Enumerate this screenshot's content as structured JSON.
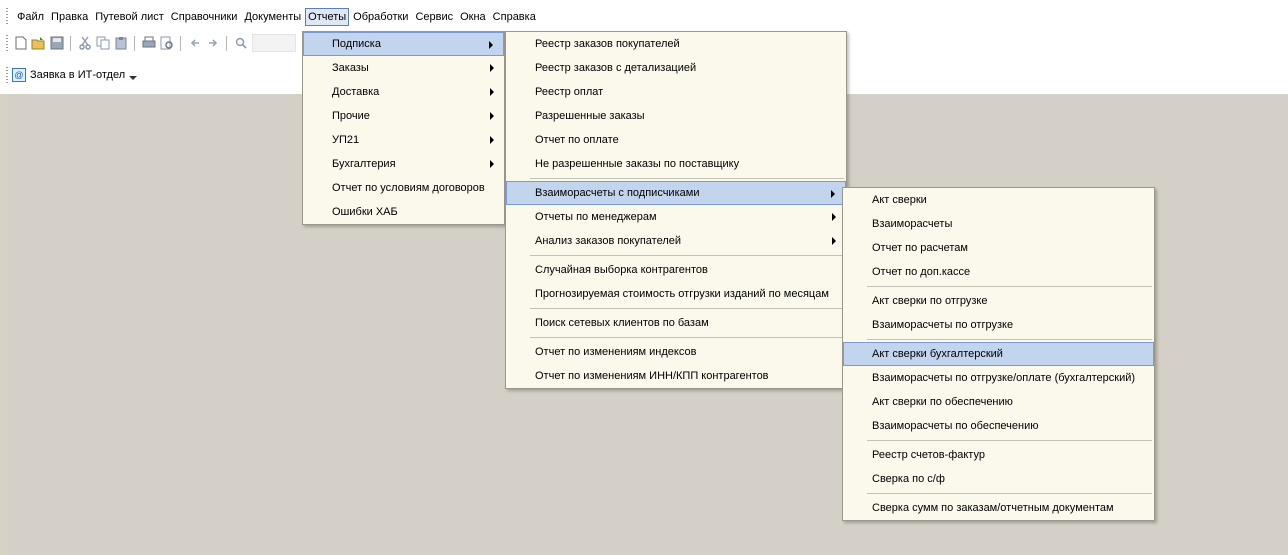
{
  "menubar": {
    "items": [
      {
        "label": "Файл",
        "active": false
      },
      {
        "label": "Правка",
        "active": false
      },
      {
        "label": "Путевой лист",
        "active": false
      },
      {
        "label": "Справочники",
        "active": false
      },
      {
        "label": "Документы",
        "active": false
      },
      {
        "label": "Отчеты",
        "active": true
      },
      {
        "label": "Обработки",
        "active": false
      },
      {
        "label": "Сервис",
        "active": false
      },
      {
        "label": "Окна",
        "active": false
      },
      {
        "label": "Справка",
        "active": false
      }
    ]
  },
  "toolbar": {
    "icons": [
      "new-document-icon",
      "open-icon",
      "save-icon",
      "cut-icon",
      "copy-icon",
      "paste-icon",
      "print-icon",
      "print-preview-icon",
      "back-icon",
      "forward-icon",
      "search-icon"
    ]
  },
  "quick_bar": {
    "it_request_label": "Заявка в ИТ-отдел"
  },
  "menu_reports": {
    "items": [
      {
        "label": "Подписка",
        "submenu": true,
        "highlighted": true
      },
      {
        "label": "Заказы",
        "submenu": true
      },
      {
        "label": "Доставка",
        "submenu": true
      },
      {
        "label": "Прочие",
        "submenu": true
      },
      {
        "label": "УП21",
        "submenu": true
      },
      {
        "label": "Бухгалтерия",
        "submenu": true
      },
      {
        "label": "Отчет по условиям договоров",
        "submenu": false
      },
      {
        "label": "Ошибки ХАБ",
        "submenu": false
      }
    ]
  },
  "menu_subscription": {
    "items": [
      {
        "label": "Реестр заказов покупателей"
      },
      {
        "label": "Реестр заказов с детализацией"
      },
      {
        "label": "Реестр оплат"
      },
      {
        "label": "Разрешенные заказы"
      },
      {
        "label": "Отчет по оплате"
      },
      {
        "label": "Не разрешенные заказы по поставщику"
      },
      {
        "separator": true
      },
      {
        "label": "Взаиморасчеты с подписчиками",
        "submenu": true,
        "highlighted": true
      },
      {
        "label": "Отчеты по менеджерам",
        "submenu": true
      },
      {
        "label": "Анализ заказов покупателей",
        "submenu": true
      },
      {
        "separator": true
      },
      {
        "label": "Случайная выборка контрагентов"
      },
      {
        "label": "Прогнозируемая стоимость отгрузки изданий по месяцам"
      },
      {
        "separator": true
      },
      {
        "label": "Поиск сетевых клиентов по базам"
      },
      {
        "separator": true
      },
      {
        "label": "Отчет по изменениям индексов"
      },
      {
        "label": "Отчет по изменениям ИНН/КПП контрагентов"
      }
    ]
  },
  "menu_settlements": {
    "items": [
      {
        "label": "Акт сверки"
      },
      {
        "label": "Взаиморасчеты"
      },
      {
        "label": "Отчет по расчетам"
      },
      {
        "label": "Отчет по доп.кассе"
      },
      {
        "separator": true
      },
      {
        "label": "Акт сверки по отгрузке"
      },
      {
        "label": "Взаиморасчеты по отгрузке"
      },
      {
        "separator": true
      },
      {
        "label": "Акт сверки бухгалтерский",
        "highlighted": true
      },
      {
        "label": "Взаиморасчеты по отгрузке/оплате (бухгалтерский)"
      },
      {
        "label": "Акт сверки по обеспечению"
      },
      {
        "label": "Взаиморасчеты по обеспечению"
      },
      {
        "separator": true
      },
      {
        "label": "Реестр счетов-фактур"
      },
      {
        "label": "Сверка по с/ф"
      },
      {
        "separator": true
      },
      {
        "label": "Сверка сумм по заказам/отчетным документам"
      }
    ]
  }
}
